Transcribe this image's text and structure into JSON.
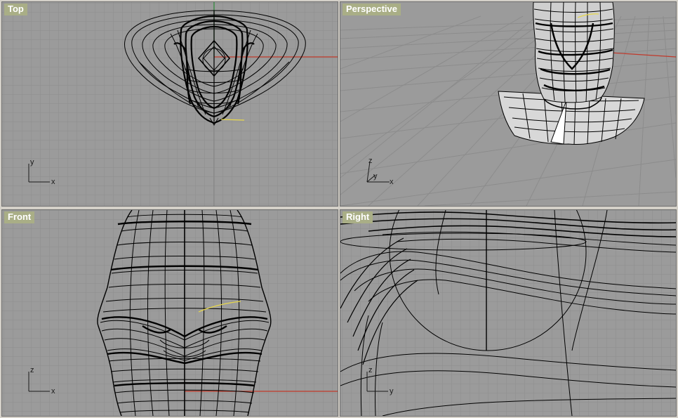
{
  "viewports": {
    "top": {
      "title": "Top",
      "axis_v": "y",
      "axis_h": "x"
    },
    "perspective": {
      "title": "Perspective",
      "axis_v": "z",
      "axis_d": "y",
      "axis_h": "x"
    },
    "front": {
      "title": "Front",
      "axis_v": "z",
      "axis_h": "x"
    },
    "right": {
      "title": "Right",
      "axis_v": "z",
      "axis_h": "y"
    }
  },
  "colors": {
    "viewport_bg": "#9b9b9b",
    "grid_minor": "#8d8d8d",
    "grid_major": "#858585",
    "x_axis": "#c0392b",
    "y_axis": "#2e8b3a",
    "wire": "#000000",
    "selection": "#e8d84a",
    "title_bg": "#a9ae86",
    "frame": "#d4d0c8"
  }
}
